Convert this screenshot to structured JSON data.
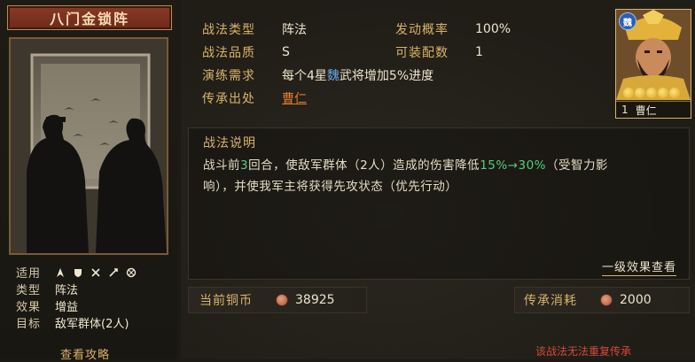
{
  "left": {
    "title": "八门金锁阵",
    "info": {
      "applicable_label": "适用",
      "applicable_icons": [
        "infantry-icon",
        "shield-icon",
        "crossed-swords-icon",
        "bow-icon",
        "siege-icon"
      ],
      "type_label": "类型",
      "type_value": "阵法",
      "effect_label": "效果",
      "effect_value": "增益",
      "target_label": "目标",
      "target_value": "敌军群体(2人)"
    },
    "strategy_link": "查看攻略"
  },
  "attrs": {
    "type_label": "战法类型",
    "type_value": "阵法",
    "rate_label": "发动概率",
    "rate_value": "100%",
    "quality_label": "战法品质",
    "quality_value": "S",
    "slots_label": "可装配数",
    "slots_value": "1",
    "train_label": "演练需求",
    "train_prefix": "每个4星",
    "train_faction": "魏",
    "train_suffix": "武将增加5%进度",
    "source_label": "传承出处",
    "source_value": "曹仁"
  },
  "general": {
    "faction": "魏",
    "level": "1",
    "name": "曹仁",
    "stars": 5
  },
  "description": {
    "title": "战法说明",
    "line1_a": "战斗前",
    "line1_b": "3",
    "line1_c": "回合，使敌军群体（2人）造成的伤害降低",
    "line1_d": "15%→30%",
    "line1_e": "（受智力影",
    "line2": "响），并使我军主将获得先攻状态（优先行动）",
    "level_link": "一级效果查看"
  },
  "money": {
    "copper_label": "当前铜币",
    "copper_value": "38925",
    "cost_label": "传承消耗",
    "cost_value": "2000"
  },
  "warning": "该战法无法重复传承",
  "colors": {
    "gold_label": "#d9b36a",
    "highlight_green": "#4fcf7a",
    "faction_blue": "#6aa8e8",
    "link_orange": "#e07a2a",
    "warning_red": "#d24a3a"
  }
}
